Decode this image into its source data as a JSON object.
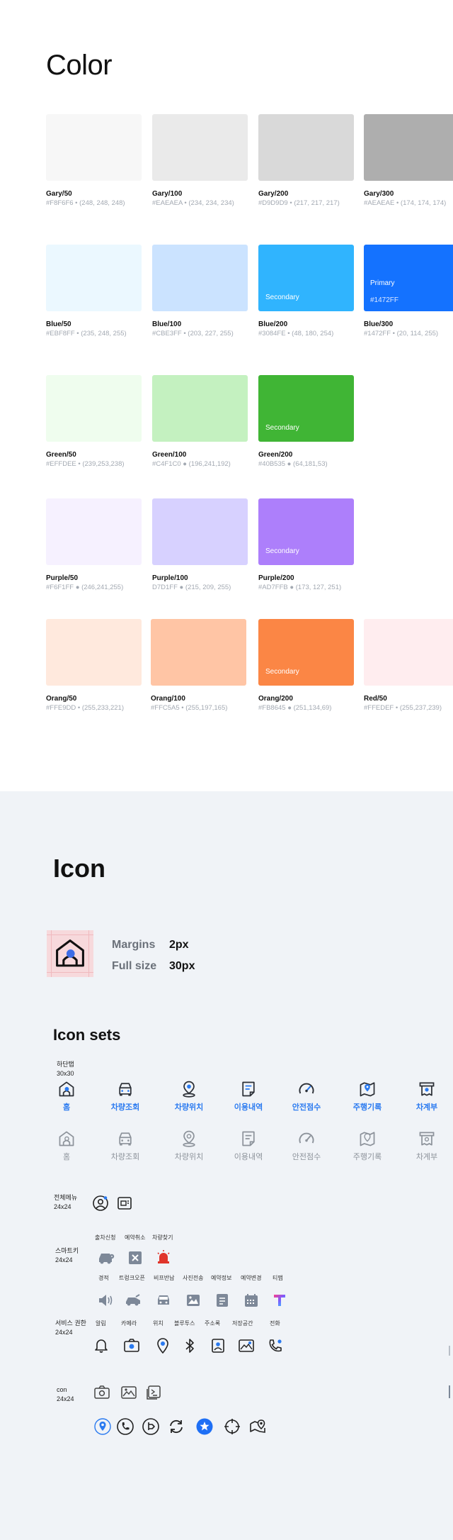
{
  "color_section": {
    "title": "Color",
    "swatches": [
      {
        "name": "Gary/50",
        "meta": "#F8F6F6 • (248, 248, 248)",
        "color": "#f7f7f7"
      },
      {
        "name": "Gary/100",
        "meta": "#EAEAEA • (234, 234, 234)",
        "color": "#eaeaea"
      },
      {
        "name": "Gary/200",
        "meta": "#D9D9D9 • (217, 217, 217)",
        "color": "#d9d9d9"
      },
      {
        "name": "Gary/300",
        "meta": "#AEAEAE • (174, 174, 174)",
        "color": "#aeaeae"
      },
      {
        "name": "Blue/50",
        "meta": "#EBF8FF • (235, 248, 255)",
        "color": "#ebf8ff"
      },
      {
        "name": "Blue/100",
        "meta": "#CBE3FF • (203, 227, 255)",
        "color": "#cbe3ff"
      },
      {
        "name": "Blue/200",
        "meta": "#3084FE • (48, 180, 254)",
        "color": "#30b4fe",
        "inner": "Secondary"
      },
      {
        "name": "Blue/300",
        "meta": "#1472FF • (20, 114, 255)",
        "color": "#1472ff",
        "inner_top": "Primary",
        "inner_hex": "#1472FF"
      },
      {
        "name": "Green/50",
        "meta": "#EFFDEE • (239,253,238)",
        "color": "#effdee"
      },
      {
        "name": "Green/100",
        "meta": "#C4F1C0 ● (196,241,192)",
        "color": "#c4f1c0"
      },
      {
        "name": "Green/200",
        "meta": "#40B535 ● (64,181,53)",
        "color": "#40b535",
        "inner": "Secondary"
      },
      {
        "name": "Purple/50",
        "meta": "#F6F1FF ● (246,241,255)",
        "color": "#f6f1ff"
      },
      {
        "name": "Purple/100",
        "meta": "D7D1FF ● (215, 209, 255)",
        "color": "#d7d1ff"
      },
      {
        "name": "Purple/200",
        "meta": "#AD7FFB ● (173, 127, 251)",
        "color": "#ad7ffb",
        "inner": "Secondary"
      },
      {
        "name": "Orang/50",
        "meta": "#FFE9DD • (255,233,221)",
        "color": "#ffe9dd"
      },
      {
        "name": "Orang/100",
        "meta": "#FFC5A5 • (255,197,165)",
        "color": "#ffc5a5"
      },
      {
        "name": "Orang/200",
        "meta": "#FB8645 ● (251,134,69)",
        "color": "#fb8645",
        "inner": "Secondary"
      },
      {
        "name": "Red/50",
        "meta": "#FFEDEF • (255,237,239)",
        "color": "#ffedef"
      }
    ]
  },
  "icon_section": {
    "title": "Icon",
    "spec": {
      "margins_label": "Margins",
      "margins_value": "2px",
      "fullsize_label": "Full size",
      "fullsize_value": "30px"
    },
    "sets_title": "Icon sets",
    "tab_bar": {
      "label_line1": "하단탭",
      "label_line2": "30x30",
      "items": [
        {
          "label": "홈",
          "icon": "home-icon"
        },
        {
          "label": "차량조회",
          "icon": "car-icon"
        },
        {
          "label": "차량위치",
          "icon": "car-location-icon"
        },
        {
          "label": "이용내역",
          "icon": "history-icon"
        },
        {
          "label": "안전점수",
          "icon": "gauge-icon"
        },
        {
          "label": "주행기록",
          "icon": "map-pin-icon"
        },
        {
          "label": "차계부",
          "icon": "receipt-icon"
        }
      ]
    },
    "all_menu": {
      "label_line1": "전체메뉴",
      "label_line2": "24x24"
    },
    "smart_key": {
      "label_line1": "스마트키",
      "label_line2": "24x24",
      "row1": [
        "출차신청",
        "예약취소",
        "차량찾기"
      ],
      "row2": [
        "경적",
        "트렁크오픈",
        "비프반납",
        "사진전송",
        "예약정보",
        "예약변경",
        "티맵"
      ]
    },
    "service": {
      "label_line1": "서비스 권한",
      "label_line2": "24x24",
      "row": [
        "알림",
        "카메라",
        "위치",
        "블루투스",
        "주소록",
        "저장공간",
        "전화"
      ]
    },
    "con": {
      "label_line1": "con",
      "label_line2": "24x24"
    },
    "colors": {
      "accent": "#2a7af0",
      "inactive": "#8d939b",
      "icon_gray": "#7d8898",
      "dark": "#222222"
    }
  }
}
